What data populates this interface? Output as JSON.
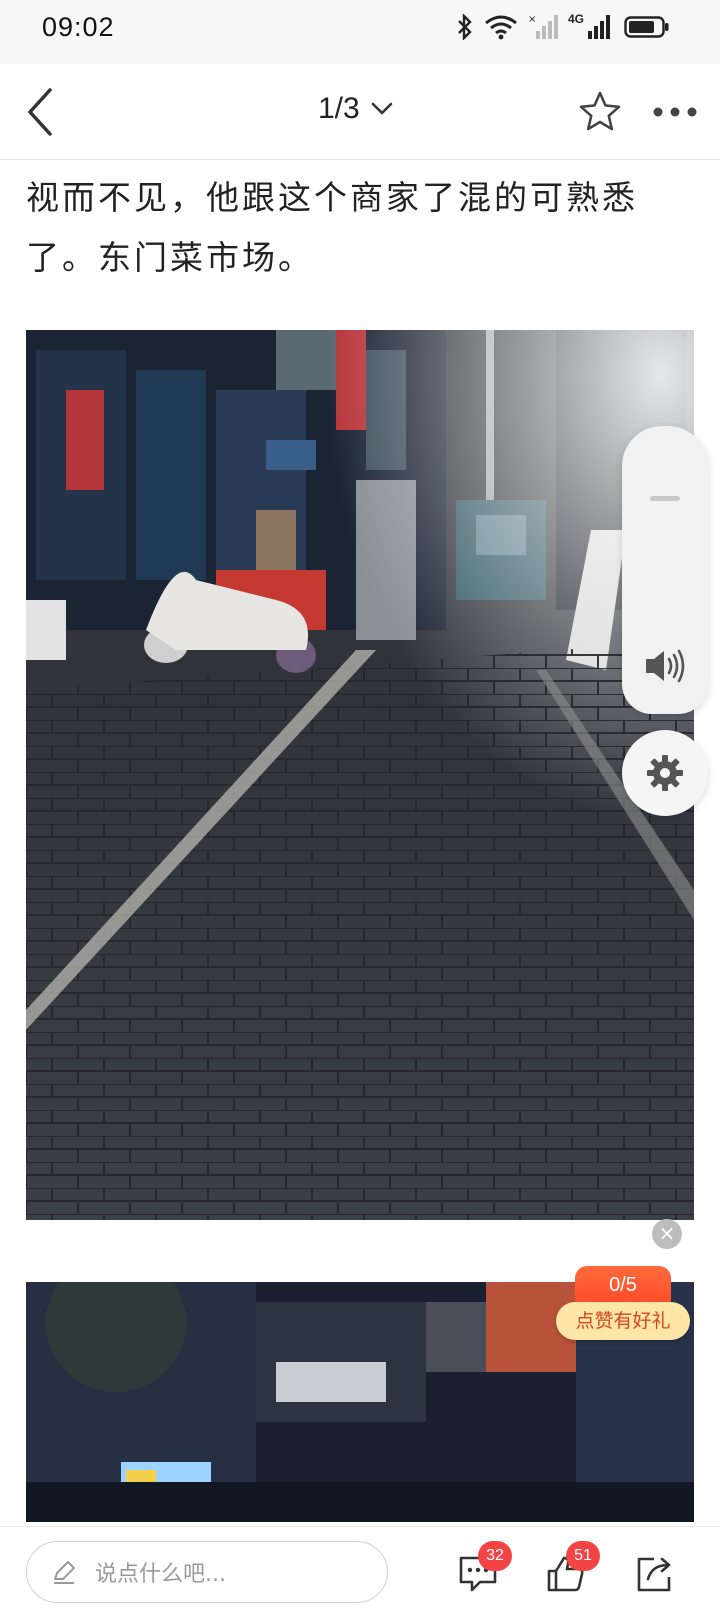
{
  "status_bar": {
    "time": "09:02",
    "network": "4G",
    "icons": [
      "bluetooth-icon",
      "wifi-icon",
      "signal-muted-icon",
      "signal-icon",
      "battery-icon"
    ]
  },
  "nav": {
    "page_indicator": "1/3",
    "icons": [
      "back-icon",
      "chevron-down-icon",
      "star-icon",
      "more-icon"
    ]
  },
  "article": {
    "text": "视而不见，他跟这个商家了混的可熟悉了。东门菜市场。"
  },
  "side_panel": {
    "icons": [
      "volume-icon",
      "gear-icon"
    ]
  },
  "reward": {
    "count": "0/5",
    "label": "点赞有好礼",
    "close": "×"
  },
  "bottom_bar": {
    "comment_placeholder": "说点什么吧...",
    "comment_count": "32",
    "like_count": "51",
    "icons": [
      "edit-icon",
      "comment-icon",
      "like-icon",
      "share-icon"
    ]
  },
  "colors": {
    "accent": "#ff4d2a",
    "badge": "#f24444",
    "reward_bg": "#fde6a8"
  }
}
